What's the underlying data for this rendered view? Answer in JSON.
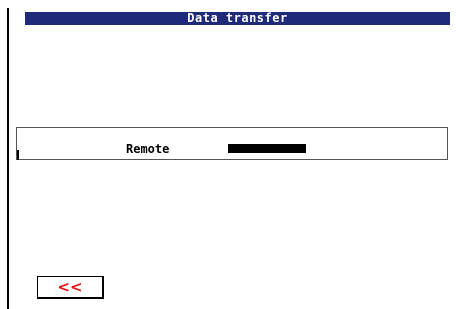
{
  "window": {
    "title": "Data transfer"
  },
  "panel": {
    "label": "Remote",
    "indicator_color": "#000000"
  },
  "footer": {
    "back_button_label": "<<",
    "back_button_color": "#e01010"
  },
  "colors": {
    "title_bar": "#1f2a7a",
    "title_text": "#ffffff",
    "background": "#ffffff"
  }
}
